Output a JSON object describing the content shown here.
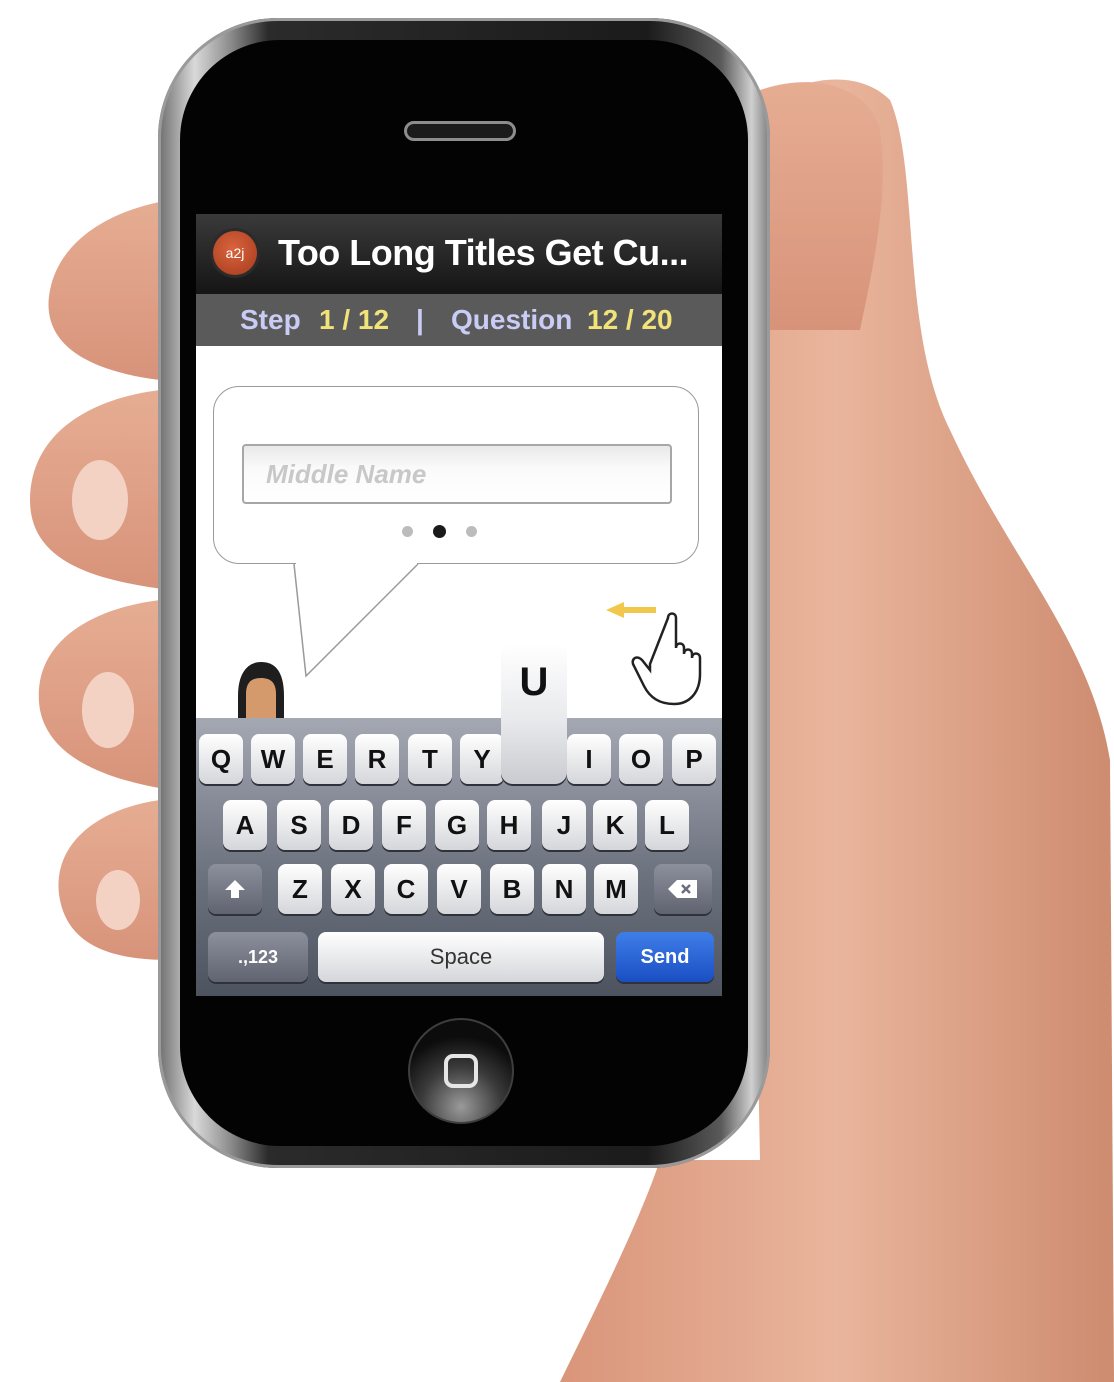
{
  "header": {
    "logo_text": "a2j",
    "title": "Too Long Titles Get Cu..."
  },
  "progress": {
    "step_label": "Step",
    "step_value": "1 / 12",
    "separator": "|",
    "question_label": "Question",
    "question_value": "12 / 20"
  },
  "question": {
    "input_placeholder": "Middle Name",
    "input_value": "",
    "page_dots": {
      "count": 3,
      "active_index": 1
    }
  },
  "keyboard": {
    "row1": [
      "Q",
      "W",
      "E",
      "R",
      "T",
      "Y",
      "U",
      "I",
      "O",
      "P"
    ],
    "row2": [
      "A",
      "S",
      "D",
      "F",
      "G",
      "H",
      "J",
      "K",
      "L"
    ],
    "row3": [
      "Z",
      "X",
      "C",
      "V",
      "B",
      "N",
      "M"
    ],
    "pressed_key": "U",
    "numbers_label": ".,123",
    "space_label": "Space",
    "send_label": "Send"
  },
  "colors": {
    "title_bar": "#1f1f1f",
    "progress_bar": "#5a5a5a",
    "progress_label": "#c9ccf4",
    "progress_value": "#f2e27a",
    "send_key": "#2a63d6",
    "logo": "#c44f2c"
  },
  "icons": [
    "app-logo-icon",
    "avatar-icon",
    "swipe-hand-icon",
    "swipe-arrow-icon",
    "shift-icon",
    "backspace-icon",
    "home-button-icon"
  ]
}
